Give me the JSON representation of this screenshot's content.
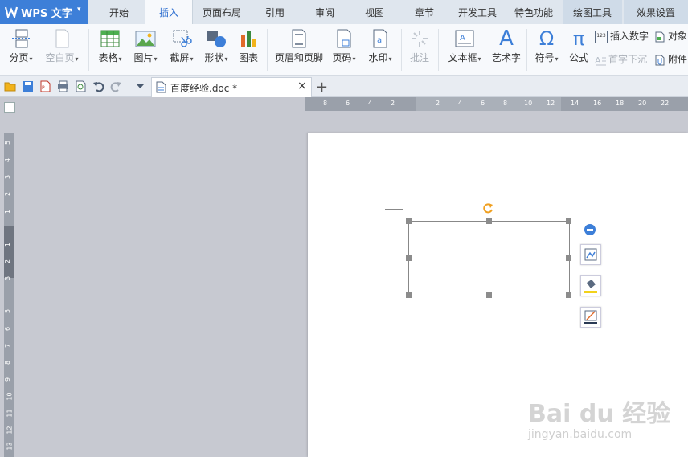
{
  "app": {
    "name": "WPS 文字",
    "menu_arrow": "▾"
  },
  "tabs": [
    {
      "label": "开始"
    },
    {
      "label": "插入",
      "active": true
    },
    {
      "label": "页面布局"
    },
    {
      "label": "引用"
    },
    {
      "label": "审阅"
    },
    {
      "label": "视图"
    },
    {
      "label": "章节"
    },
    {
      "label": "开发工具"
    },
    {
      "label": "特色功能"
    },
    {
      "label": "绘图工具",
      "contextual": true
    },
    {
      "label": "效果设置",
      "contextual": true
    }
  ],
  "ribbon": {
    "page_break": "分页",
    "blank_page": "空白页",
    "table": "表格",
    "picture": "图片",
    "screenshot": "截屏",
    "shapes": "形状",
    "chart": "图表",
    "header_footer": "页眉和页脚",
    "page_number": "页码",
    "watermark": "水印",
    "comment": "批注",
    "textbox": "文本框",
    "wordart": "艺术字",
    "symbol": "符号",
    "formula": "公式",
    "insert_number": "插入数字",
    "object": "对象",
    "drop_cap": "首字下沉",
    "attachment": "附件",
    "symbol_glyph": "Ω",
    "formula_glyph": "π",
    "wordart_glyph": "A",
    "number_icon_text": "123"
  },
  "document_tab": {
    "name": "百度经验.doc *",
    "close": "×",
    "new_tab": "+"
  },
  "ruler": {
    "h_numbers": [
      "8",
      "6",
      "4",
      "2",
      "2",
      "4",
      "6",
      "8",
      "10",
      "12",
      "14",
      "16",
      "18",
      "20",
      "22"
    ],
    "v_numbers": [
      "5",
      "4",
      "3",
      "2",
      "1",
      "1",
      "2",
      "3",
      "5",
      "6",
      "7",
      "8",
      "9",
      "10",
      "11",
      "12",
      "13"
    ]
  },
  "watermark": {
    "logo": "Bai du 经验",
    "url": "jingyan.baidu.com"
  },
  "colors": {
    "accent": "#3d7fd8",
    "rotate_handle": "#f0a020"
  }
}
